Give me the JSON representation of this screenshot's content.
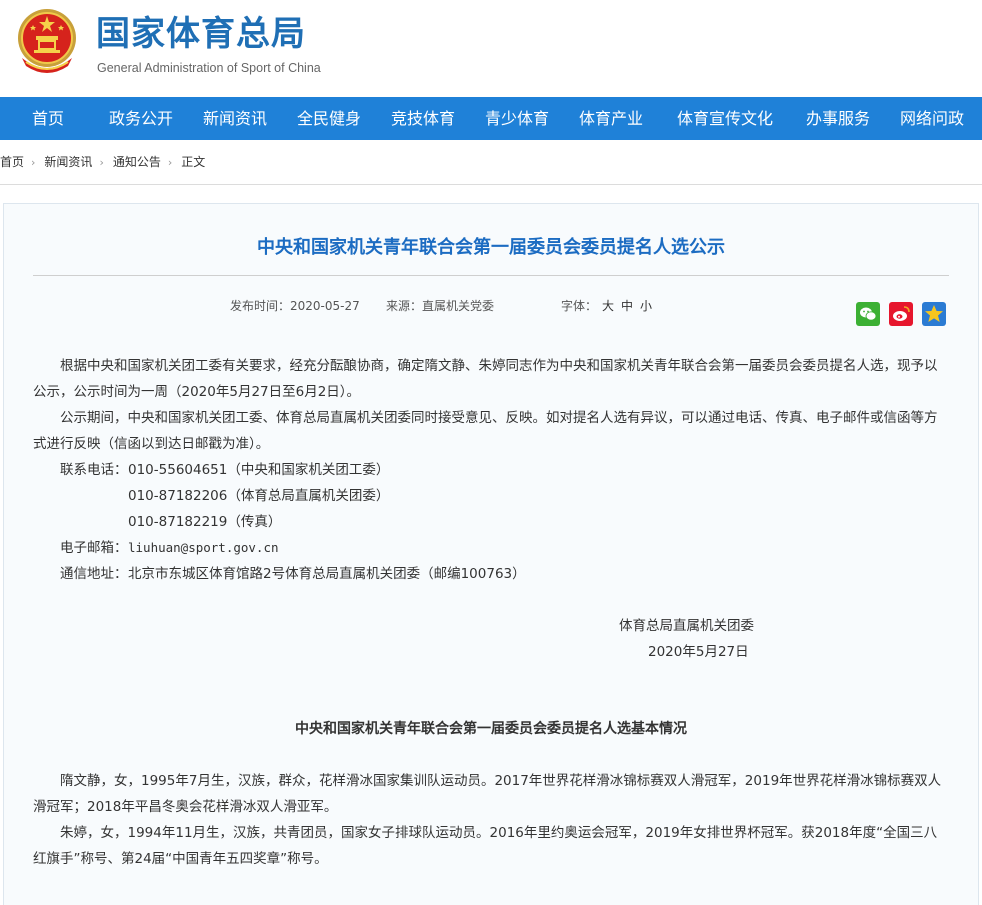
{
  "site": {
    "name_cn": "国家体育总局",
    "name_en": "General Administration of Sport of China"
  },
  "nav": [
    "首页",
    "政务公开",
    "新闻资讯",
    "全民健身",
    "竞技体育",
    "青少体育",
    "体育产业",
    "体育宣传文化",
    "办事服务",
    "网络问政"
  ],
  "breadcrumb": [
    "首页",
    "新闻资讯",
    "通知公告",
    "正文"
  ],
  "article": {
    "title": "中央和国家机关青年联合会第一届委员会委员提名人选公示",
    "publish_label": "发布时间：2020-05-27",
    "source_label": "来源：直属机关党委",
    "font_label": "字体：",
    "font_sizes": [
      "大",
      "中",
      "小"
    ],
    "paragraphs": [
      "　　根据中央和国家机关团工委有关要求，经充分酝酿协商，确定隋文静、朱婷同志作为中央和国家机关青年联合会第一届委员会委员提名人选，现予以公示，公示时间为一周（2020年5月27日至6月2日）。",
      "　　公示期间，中央和国家机关团工委、体育总局直属机关团委同时接受意见、反映。如对提名人选有异议，可以通过电话、传真、电子邮件或信函等方式进行反映（信函以到达日邮戳为准）。"
    ],
    "contacts": {
      "phone_label": "联系电话：",
      "phone1": "010-55604651（中央和国家机关团工委）",
      "phone2": "010-87182206（体育总局直属机关团委）",
      "phone3": "010-87182219（传真）",
      "email_label": "电子邮箱：",
      "email": "liuhuan@sport.gov.cn",
      "address_label": "通信地址：",
      "address": "北京市东城区体育馆路2号体育总局直属机关团委（邮编100763）"
    },
    "signature": "体育总局直属机关团委",
    "date": "2020年5月27日",
    "section_title": "中央和国家机关青年联合会第一届委员会委员提名人选基本情况",
    "bios": [
      "　　隋文静，女，1995年7月生，汉族，群众，花样滑冰国家集训队运动员。2017年世界花样滑冰锦标赛双人滑冠军，2019年世界花样滑冰锦标赛双人滑冠军；2018年平昌冬奥会花样滑冰双人滑亚军。",
      "　　朱婷，女，1994年11月生，汉族，共青团员，国家女子排球队运动员。2016年里约奥运会冠军，2019年女排世界杯冠军。获2018年度“全国三八红旗手”称号、第24届“中国青年五四奖章”称号。"
    ]
  },
  "share": [
    "wechat-icon",
    "weibo-icon",
    "favorite-icon"
  ],
  "colors": {
    "nav_bg": "#1f81d8",
    "title_blue": "#1c6cc2",
    "logo_blue": "#1f6fb5",
    "panel_bg": "#f8fbfd"
  }
}
